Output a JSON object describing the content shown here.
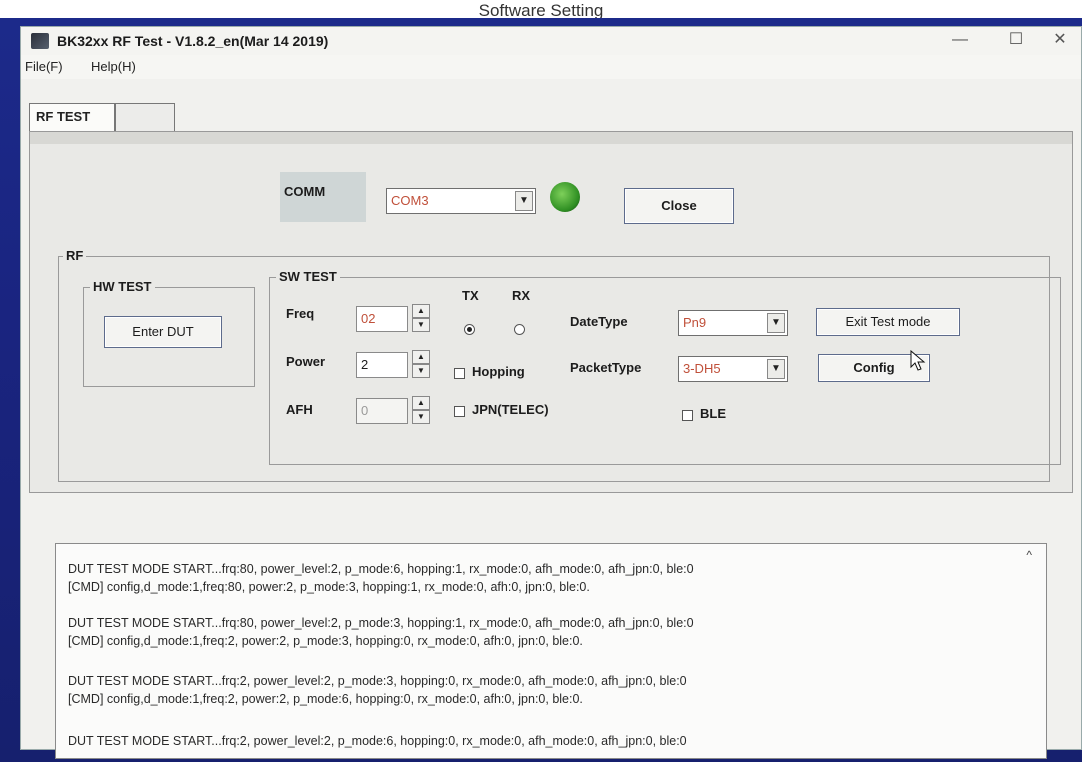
{
  "caption": "Software Setting",
  "window": {
    "title": "BK32xx RF Test - V1.8.2_en(Mar 14 2019)",
    "controls": {
      "minimize": "—",
      "maximize": "☐",
      "close": "✕"
    }
  },
  "menu": {
    "file": "File(F)",
    "help": "Help(H)"
  },
  "tabs": {
    "active": "RF TEST"
  },
  "comm": {
    "label": "COMM",
    "port_value": "COM3",
    "status_led_color": "#2f8f23",
    "close_button": "Close"
  },
  "rf_group": {
    "title": "RF"
  },
  "hw_test": {
    "title": "HW TEST",
    "enter_dut_button": "Enter DUT"
  },
  "sw_test": {
    "title": "SW TEST",
    "freq_label": "Freq",
    "freq_value": "02",
    "power_label": "Power",
    "power_value": "2",
    "afh_label": "AFH",
    "afh_value": "0",
    "tx_label": "TX",
    "rx_label": "RX",
    "tx_selected": true,
    "hopping_label": "Hopping",
    "jpn_label": "JPN(TELEC)",
    "datetype_label": "DateType",
    "datetype_value": "Pn9",
    "packettype_label": "PacketType",
    "packettype_value": "3-DH5",
    "ble_label": "BLE",
    "exit_test_button": "Exit Test mode",
    "config_button": "Config"
  },
  "log": [
    "DUT TEST MODE START...frq:80, power_level:2, p_mode:6, hopping:1, rx_mode:0, afh_mode:0, afh_jpn:0, ble:0",
    "[CMD] config,d_mode:1,freq:80, power:2, p_mode:3, hopping:1, rx_mode:0, afh:0, jpn:0, ble:0.",
    "DUT TEST MODE START...frq:80, power_level:2, p_mode:3, hopping:1, rx_mode:0, afh_mode:0, afh_jpn:0, ble:0",
    "[CMD] config,d_mode:1,freq:2, power:2, p_mode:3, hopping:0, rx_mode:0, afh:0, jpn:0, ble:0.",
    "DUT TEST MODE START...frq:2, power_level:2, p_mode:3, hopping:0, rx_mode:0, afh_mode:0, afh_jpn:0, ble:0",
    "[CMD] config,d_mode:1,freq:2, power:2, p_mode:6, hopping:0, rx_mode:0, afh:0, jpn:0, ble:0.",
    "DUT TEST MODE START...frq:2, power_level:2, p_mode:6, hopping:0, rx_mode:0, afh_mode:0, afh_jpn:0, ble:0"
  ]
}
